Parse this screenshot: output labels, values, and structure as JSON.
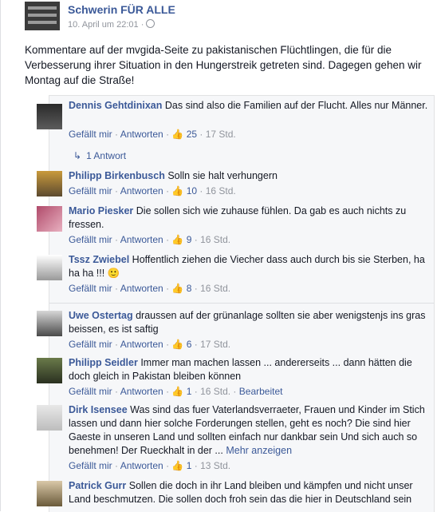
{
  "post": {
    "page_name": "Schwerin FÜR ALLE",
    "time": "10. April um 22:01 ·",
    "text": "Kommentare auf der mvgida-Seite zu pakistanischen Flüchtlingen, die für die Verbesserung ihrer Situation in den Hungerstreik getreten sind. Dagegen gehen wir Montag auf die Straße!"
  },
  "ui": {
    "like": "Gefällt mir",
    "sep": " · ",
    "reply": "Antworten",
    "like_icon": "thumbs-up-icon",
    "reply_arrow_icon": "reply-arrow-icon",
    "globe_icon": "globe-icon"
  },
  "comments": [
    {
      "author": "Dennis Gehtdinixan",
      "text": "Das sind also die Familien auf der Flucht. Alles nur Männer.",
      "likes": "25",
      "time": "17 Std.",
      "replies": "1 Antwort"
    },
    {
      "author": "Philipp Birkenbusch",
      "text": "Solln sie halt verhungern",
      "likes": "10",
      "time": "16 Std."
    },
    {
      "author": "Mario Piesker",
      "text": "Die sollen sich wie zuhause fühlen. Da gab es auch nichts zu fressen.",
      "likes": "9",
      "time": "16 Std."
    },
    {
      "author": "Tssz Zwiebel",
      "text": "Hoffentlich ziehen die Viecher dass auch durch bis sie Sterben, ha ha ha !!! 🙂",
      "likes": "8",
      "time": "16 Std."
    },
    {
      "author": "Uwe Ostertag",
      "text": "draussen auf der grünanlage sollten sie aber wenigstenjs ins gras beissen, es ist saftig",
      "likes": "6",
      "time": "17 Std."
    },
    {
      "author": "Philipp Seidler",
      "text": "Immer man machen lassen ... andererseits ... dann hätten die doch gleich in Pakistan bleiben können",
      "likes": "1",
      "time": "16 Std.",
      "edited": "Bearbeitet"
    },
    {
      "author": "Dirk Isensee",
      "text": "Was sind das fuer Vaterlandsverraeter, Frauen und Kinder im Stich lassen und dann hier solche Forderungen stellen, geht es noch? Die sind hier Gaeste in unseren Land und sollten einfach nur dankbar sein Und sich auch so benehmen! Der Rueckhalt in der ...",
      "more": "Mehr anzeigen",
      "likes": "1",
      "time": "13 Std."
    },
    {
      "author": "Patrick Gurr",
      "text": "Sollen die doch in ihr Land bleiben und kämpfen und nicht unser Land beschmutzen. Die sollen doch froh sein das die hier in Deutschland sein"
    }
  ]
}
